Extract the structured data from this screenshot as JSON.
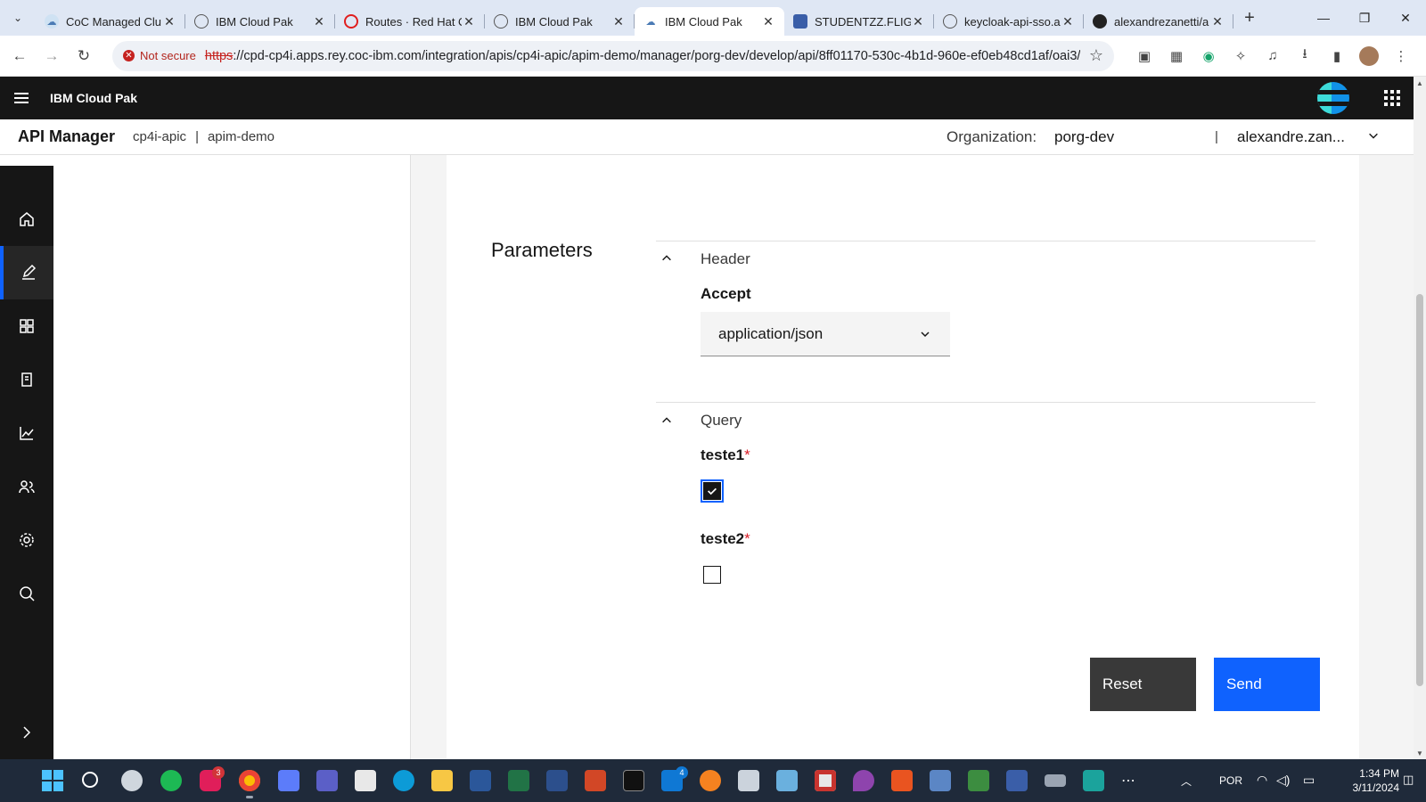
{
  "browser": {
    "tabs": [
      {
        "title": "CoC Managed Clu",
        "active": false
      },
      {
        "title": "IBM Cloud Pak",
        "active": false
      },
      {
        "title": "Routes · Red Hat O",
        "active": false
      },
      {
        "title": "IBM Cloud Pak",
        "active": false
      },
      {
        "title": "IBM Cloud Pak",
        "active": true
      },
      {
        "title": "STUDENTZZ.FLIGH",
        "active": false
      },
      {
        "title": "keycloak-api-sso.a",
        "active": false
      },
      {
        "title": "alexandrezanetti/a",
        "active": false
      }
    ],
    "security_label": "Not secure",
    "url_scheme": "https",
    "url_rest": "://cpd-cp4i.apps.rey.coc-ibm.com/integration/apis/cp4i-apic/apim-demo/manager/porg-dev/develop/api/8ff01170-530c-4b1d-960e-ef0eb48cd1af/oai3/"
  },
  "header": {
    "product_name": "IBM Cloud Pak"
  },
  "subheader": {
    "app_title": "API Manager",
    "breadcrumb_1": "cp4i-apic",
    "breadcrumb_sep": "|",
    "breadcrumb_2": "apim-demo",
    "org_label": "Organization:",
    "org_value": "porg-dev",
    "user_sep": "|",
    "user_name": "alexandre.zan..."
  },
  "rail": {
    "items": [
      {
        "icon": "home-icon",
        "active": false
      },
      {
        "icon": "edit-icon",
        "active": true
      },
      {
        "icon": "apps-grid-icon",
        "active": false
      },
      {
        "icon": "catalog-icon",
        "active": false
      },
      {
        "icon": "analytics-icon",
        "active": false
      },
      {
        "icon": "members-icon",
        "active": false
      },
      {
        "icon": "settings-icon",
        "active": false
      },
      {
        "icon": "search-icon",
        "active": false
      },
      {
        "icon": "expand-icon",
        "active": false
      }
    ]
  },
  "form": {
    "title": "Parameters",
    "header_section": {
      "label": "Header",
      "field_label": "Accept",
      "selected_value": "application/json"
    },
    "query_section": {
      "label": "Query",
      "fields": [
        {
          "label": "teste1",
          "required_mark": "*",
          "checked": true
        },
        {
          "label": "teste2",
          "required_mark": "*",
          "checked": false
        }
      ]
    },
    "buttons": {
      "reset": "Reset",
      "send": "Send"
    }
  },
  "taskbar": {
    "slack_badge": "3",
    "mail_badge": "4",
    "language": "POR",
    "time": "1:34 PM",
    "date": "3/11/2024"
  },
  "colors": {
    "primary": "#0f62fe",
    "header_bg": "#161616",
    "required": "#da1e28"
  }
}
